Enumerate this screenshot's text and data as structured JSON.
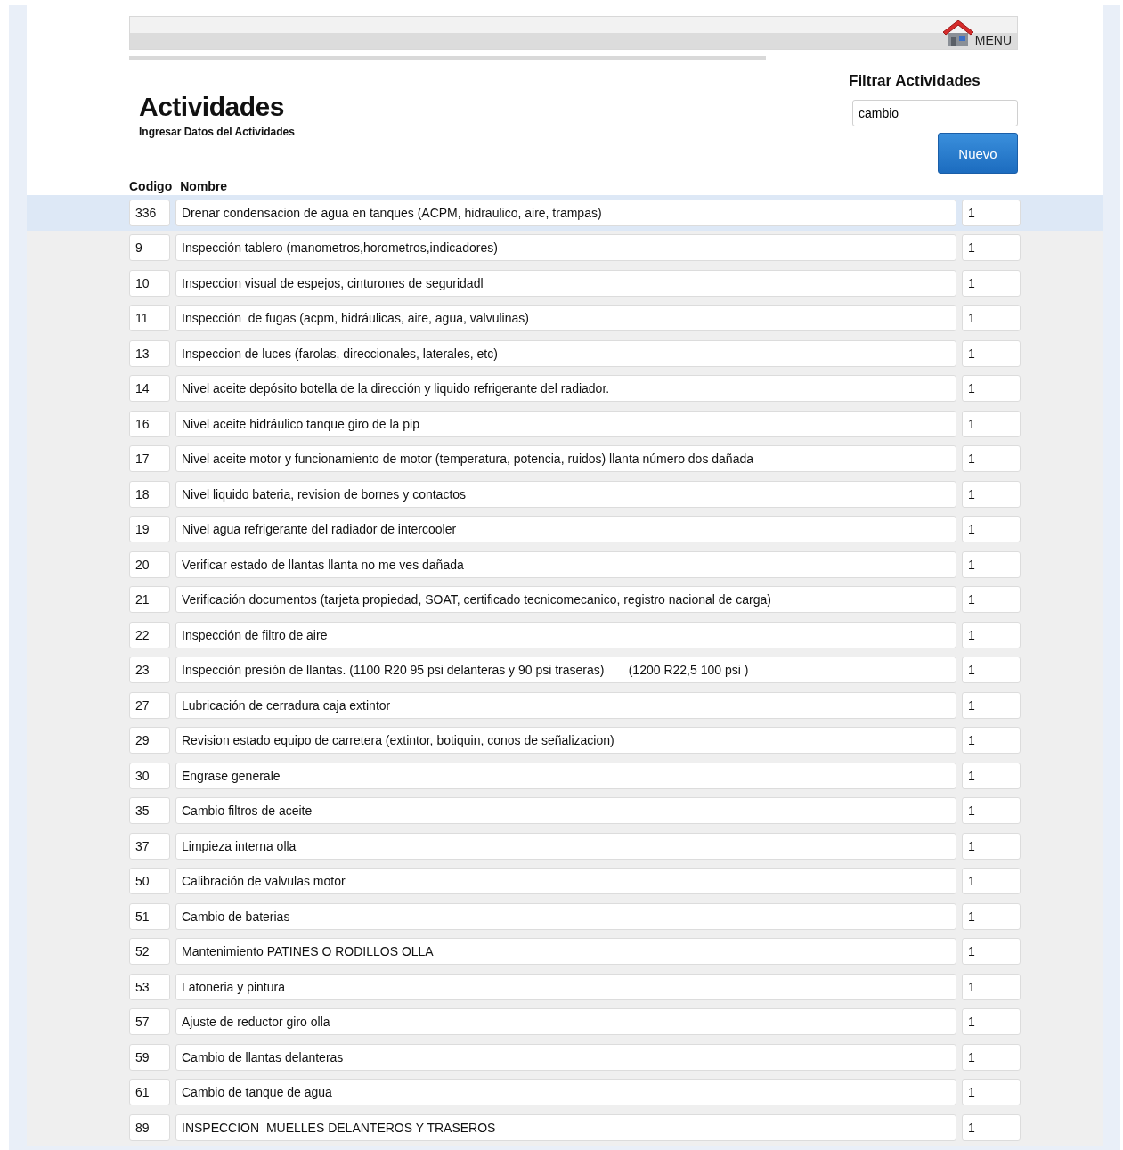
{
  "header": {
    "menu_label": "MENU"
  },
  "title": "Actividades",
  "subtitle": "Ingresar Datos del Actividades",
  "filter": {
    "label": "Filtrar Actividades",
    "value": "cambio"
  },
  "new_button": "Nuevo",
  "table": {
    "columns": [
      "Codigo",
      "Nombre"
    ],
    "rows": [
      {
        "code": "336",
        "name": "Drenar condensacion de agua en tanques (ACPM, hidraulico, aire, trampas)",
        "column_3": "1",
        "selected": true
      },
      {
        "code": "9",
        "name": "Inspección tablero (manometros,horometros,indicadores)",
        "column_3": "1",
        "selected": false
      },
      {
        "code": "10",
        "name": "Inspeccion visual de espejos, cinturones de seguridadl",
        "column_3": "1",
        "selected": false
      },
      {
        "code": "11",
        "name": "Inspección  de fugas (acpm, hidráulicas, aire, agua, valvulinas)",
        "column_3": "1",
        "selected": false
      },
      {
        "code": "13",
        "name": "Inspeccion de luces (farolas, direccionales, laterales, etc)",
        "column_3": "1",
        "selected": false
      },
      {
        "code": "14",
        "name": "Nivel aceite depósito botella de la dirección y liquido refrigerante del radiador.",
        "column_3": "1",
        "selected": false
      },
      {
        "code": "16",
        "name": "Nivel aceite hidráulico tanque giro de la pip",
        "column_3": "1",
        "selected": false
      },
      {
        "code": "17",
        "name": "Nivel aceite motor y funcionamiento de motor (temperatura, potencia, ruidos) llanta número dos dañada",
        "column_3": "1",
        "selected": false
      },
      {
        "code": "18",
        "name": "Nivel liquido bateria, revision de bornes y contactos",
        "column_3": "1",
        "selected": false
      },
      {
        "code": "19",
        "name": "Nivel agua refrigerante del radiador de intercooler",
        "column_3": "1",
        "selected": false
      },
      {
        "code": "20",
        "name": "Verificar estado de llantas llanta no me ves dañada",
        "column_3": "1",
        "selected": false
      },
      {
        "code": "21",
        "name": "Verificación documentos (tarjeta propiedad, SOAT, certificado tecnicomecanico, registro nacional de carga)",
        "column_3": "1",
        "selected": false
      },
      {
        "code": "22",
        "name": "Inspección de filtro de aire",
        "column_3": "1",
        "selected": false
      },
      {
        "code": "23",
        "name": "Inspección presión de llantas. (1100 R20 95 psi delanteras y 90 psi traseras)       (1200 R22,5 100 psi )",
        "column_3": "1",
        "selected": false
      },
      {
        "code": "27",
        "name": "Lubricación de cerradura caja extintor",
        "column_3": "1",
        "selected": false
      },
      {
        "code": "29",
        "name": "Revision estado equipo de carretera (extintor, botiquin, conos de señalizacion)",
        "column_3": "1",
        "selected": false
      },
      {
        "code": "30",
        "name": "Engrase generale",
        "column_3": "1",
        "selected": false
      },
      {
        "code": "35",
        "name": "Cambio filtros de aceite",
        "column_3": "1",
        "selected": false
      },
      {
        "code": "37",
        "name": "Limpieza interna olla",
        "column_3": "1",
        "selected": false
      },
      {
        "code": "50",
        "name": "Calibración de valvulas motor",
        "column_3": "1",
        "selected": false
      },
      {
        "code": "51",
        "name": "Cambio de baterias",
        "column_3": "1",
        "selected": false
      },
      {
        "code": "52",
        "name": "Mantenimiento PATINES O RODILLOS OLLA",
        "column_3": "1",
        "selected": false
      },
      {
        "code": "53",
        "name": "Latoneria y pintura",
        "column_3": "1",
        "selected": false
      },
      {
        "code": "57",
        "name": "Ajuste de reductor giro olla",
        "column_3": "1",
        "selected": false
      },
      {
        "code": "59",
        "name": "Cambio de llantas delanteras",
        "column_3": "1",
        "selected": false
      },
      {
        "code": "61",
        "name": "Cambio de tanque de agua",
        "column_3": "1",
        "selected": false
      },
      {
        "code": "89",
        "name": "INSPECCION  MUELLES DELANTEROS Y TRASEROS",
        "column_3": "1",
        "selected": false
      }
    ]
  }
}
